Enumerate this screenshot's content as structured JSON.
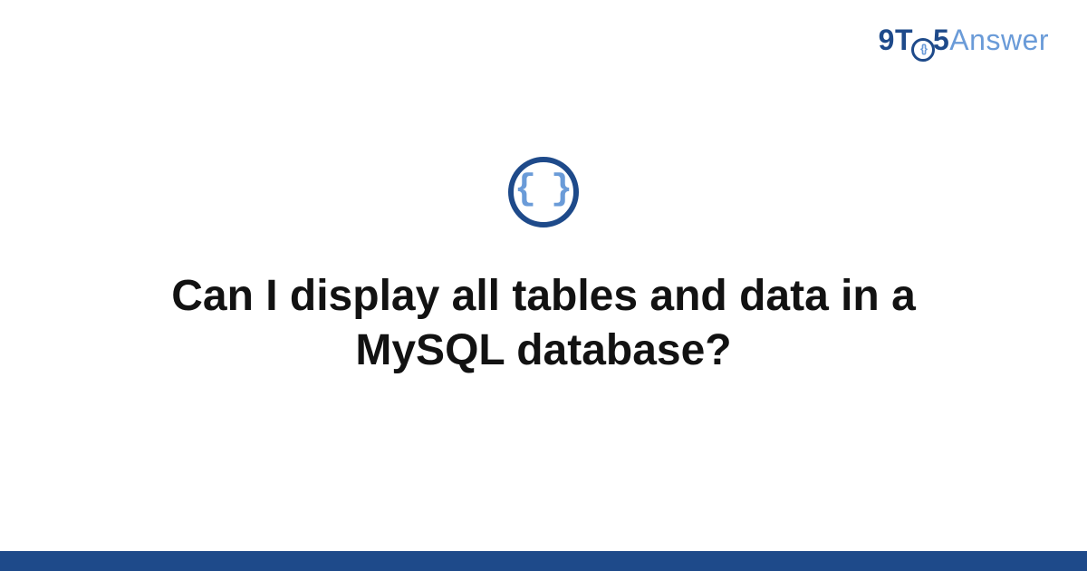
{
  "brand": {
    "prefix_9": "9",
    "letter_T": "T",
    "suffix_5": "5",
    "answer": "Answer",
    "icon_glyph": "{}"
  },
  "center_icon_glyph": "{ }",
  "question_title": "Can I display all tables and data in a MySQL database?",
  "colors": {
    "primary": "#1e4a8a",
    "accent": "#6a9bd8",
    "text": "#121212"
  }
}
